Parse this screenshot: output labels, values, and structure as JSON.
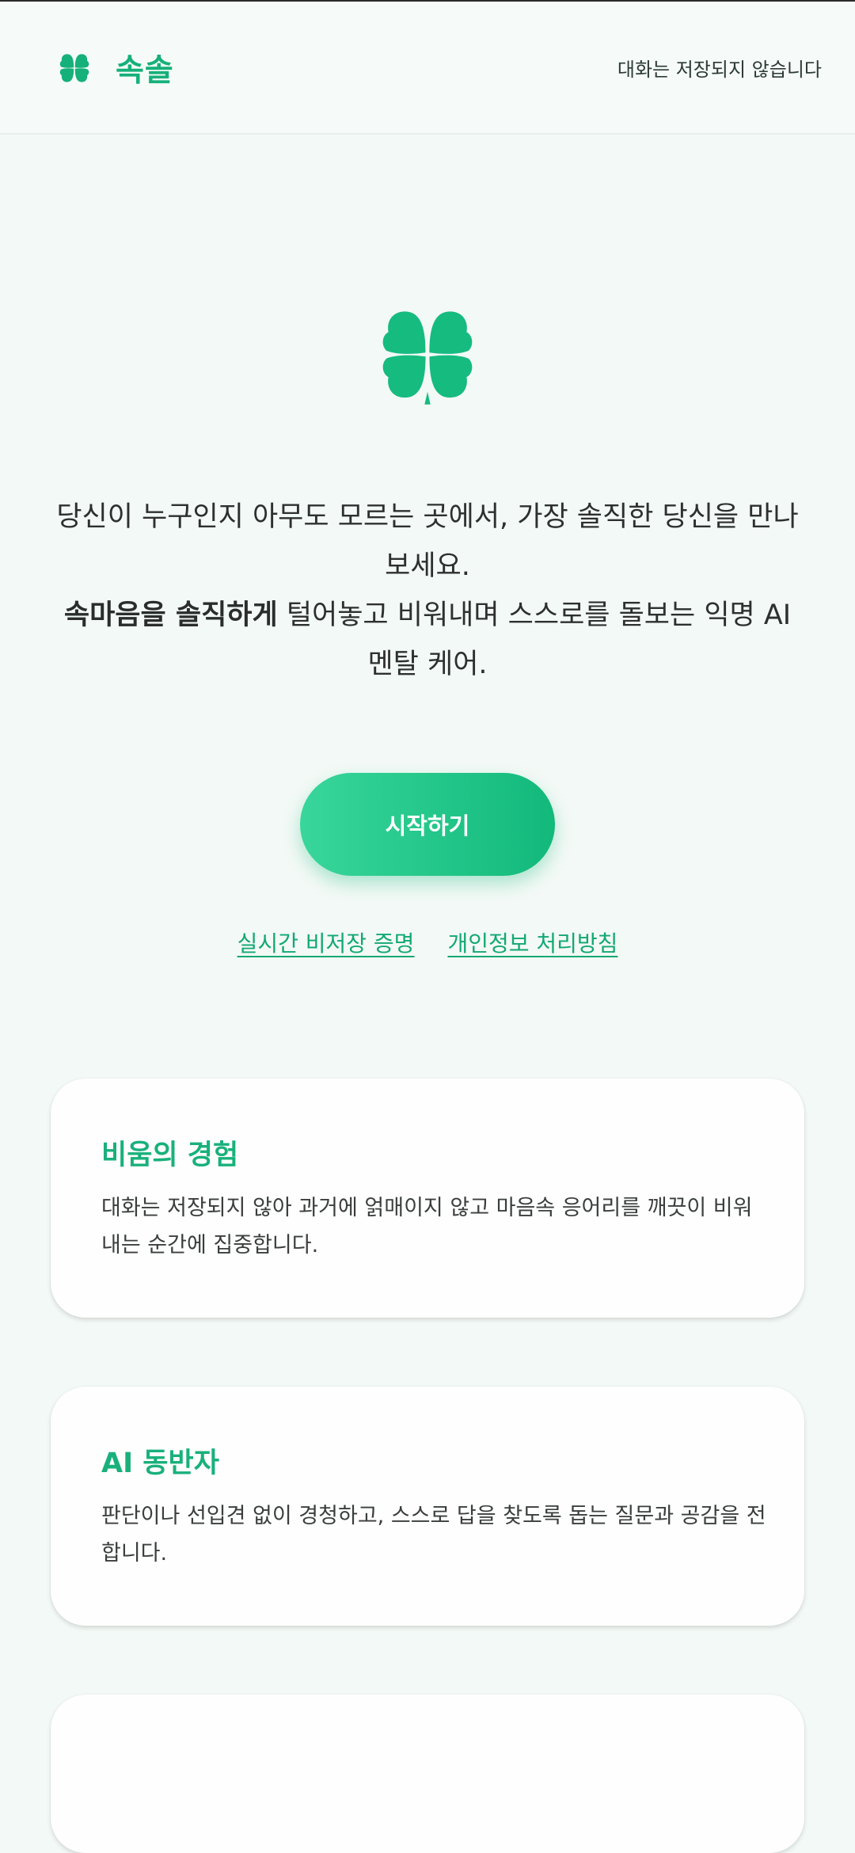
{
  "header": {
    "app_name": "속솔",
    "note": "대화는 저장되지 않습니다"
  },
  "hero": {
    "line1": "당신이 누구인지 아무도 모르는 곳에서, 가장 솔직한 당신을 만나보세요.",
    "line2_bold": "속마음을 솔직하게",
    "line2_rest": " 털어놓고 비워내며 스스로를 돌보는 익명 AI 멘탈 케어."
  },
  "cta_label": "시작하기",
  "links": {
    "no_storage_proof": "실시간 비저장 증명",
    "privacy_policy": "개인정보 처리방침"
  },
  "features": [
    {
      "title": "비움의 경험",
      "description": "대화는 저장되지 않아 과거에 얽매이지 않고 마음속 응어리를 깨끗이 비워내는 순간에 집중합니다."
    },
    {
      "title": "AI 동반자",
      "description": "판단이나 선입견 없이 경청하고, 스스로 답을 찾도록 돕는 질문과 공감을 전합니다."
    }
  ],
  "colors": {
    "brand": "#16b07a",
    "cta_start": "#38d69b",
    "cta_end": "#12b97b",
    "background": "#f3f9f6"
  },
  "icons": {
    "logo": "four-leaf-clover-icon",
    "hero": "four-leaf-clover-icon"
  }
}
